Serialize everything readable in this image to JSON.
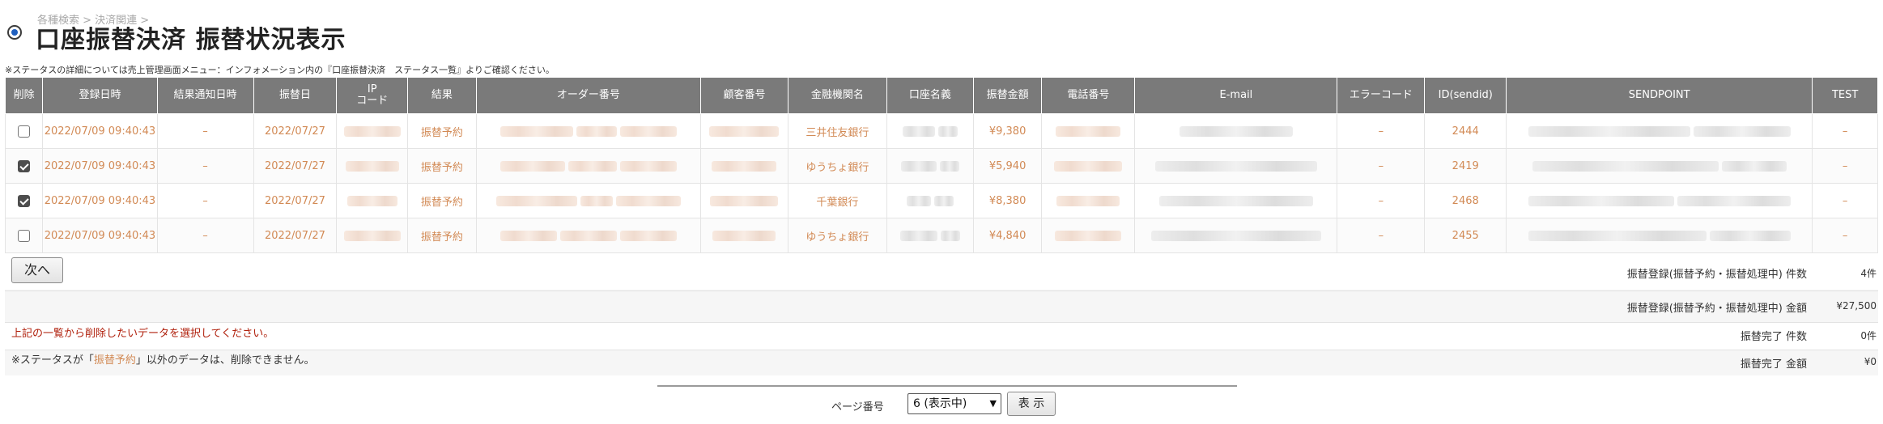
{
  "breadcrumb": "各種検索 > 決済関連 >",
  "title": "口座振替決済 振替状況表示",
  "note": "※ステータスの詳細については売上管理画面メニュー：インフォメーション内の『口座振替決済　ステータス一覧』よりご確認ください。",
  "columns": [
    "削除",
    "登録日時",
    "結果通知日時",
    "振替日",
    "IP\nコード",
    "結果",
    "オーダー番号",
    "顧客番号",
    "金融機関名",
    "口座名義",
    "振替金額",
    "電話番号",
    "E-mail",
    "エラーコード",
    "ID(sendid)",
    "SENDPOINT",
    "TEST"
  ],
  "rows": [
    {
      "checked": false,
      "registered": "2022/07/09 09:40:43",
      "notified": "–",
      "transfer_date": "2022/07/27",
      "result": "振替予約",
      "bank": "三井住友銀行",
      "amount": "¥9,380",
      "error_code": "–",
      "sendid": "2444",
      "test": "–"
    },
    {
      "checked": true,
      "registered": "2022/07/09 09:40:43",
      "notified": "–",
      "transfer_date": "2022/07/27",
      "result": "振替予約",
      "bank": "ゆうちょ銀行",
      "amount": "¥5,940",
      "error_code": "–",
      "sendid": "2419",
      "test": "–"
    },
    {
      "checked": true,
      "registered": "2022/07/09 09:40:43",
      "notified": "–",
      "transfer_date": "2022/07/27",
      "result": "振替予約",
      "bank": "千葉銀行",
      "amount": "¥8,380",
      "error_code": "–",
      "sendid": "2468",
      "test": "–"
    },
    {
      "checked": false,
      "registered": "2022/07/09 09:40:43",
      "notified": "–",
      "transfer_date": "2022/07/27",
      "result": "振替予約",
      "bank": "ゆうちょ銀行",
      "amount": "¥4,840",
      "error_code": "–",
      "sendid": "2455",
      "test": "–"
    }
  ],
  "next_button": "次へ",
  "summary": [
    {
      "label": "振替登録(振替予約・振替処理中) 件数",
      "value": "4件"
    },
    {
      "label": "振替登録(振替予約・振替処理中) 金額",
      "value": "¥27,500"
    },
    {
      "label": "振替完了 件数",
      "value": "0件"
    },
    {
      "label": "振替完了 金額",
      "value": "¥0"
    }
  ],
  "message_select": "上記の一覧から削除したいデータを選択してください。",
  "message_delete": {
    "prefix": "※ステータスが「",
    "status": "振替予約",
    "suffix": "」以外のデータは、削除できません。"
  },
  "pager": {
    "label": "ページ番号",
    "selected": "6 (表示中)",
    "show_button": "表 示"
  },
  "colors": {
    "header_bg": "#7a7a7a",
    "accent_text": "#d28a55",
    "error_text": "#b0200c"
  }
}
